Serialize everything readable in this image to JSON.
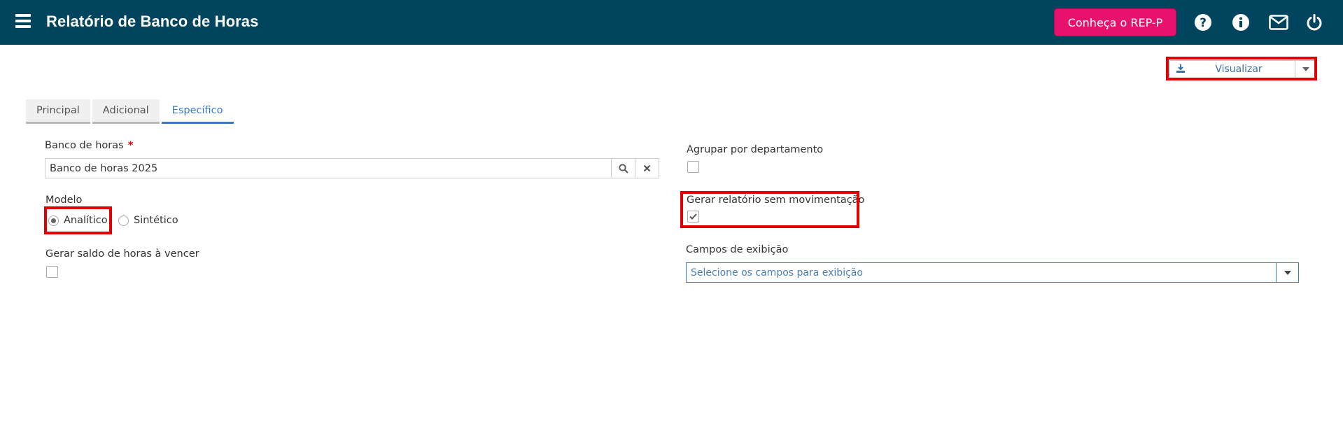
{
  "header": {
    "title": "Relatório de Banco de Horas",
    "promo_button": "Conheça o REP-P",
    "icons": [
      "help-icon",
      "info-icon",
      "mail-icon",
      "power-icon"
    ]
  },
  "toolbar": {
    "view_button": "Visualizar"
  },
  "tabs": [
    {
      "label": "Principal",
      "active": false
    },
    {
      "label": "Adicional",
      "active": false
    },
    {
      "label": "Específico",
      "active": true
    }
  ],
  "form": {
    "banco_de_horas": {
      "label": "Banco de horas",
      "required_mark": "*",
      "value": "Banco de horas 2025"
    },
    "modelo": {
      "label": "Modelo",
      "options": [
        {
          "label": "Analítico",
          "selected": true
        },
        {
          "label": "Sintético",
          "selected": false
        }
      ]
    },
    "gerar_saldo": {
      "label": "Gerar saldo de horas à vencer",
      "checked": false
    },
    "agrupar_departamento": {
      "label": "Agrupar por departamento",
      "checked": false
    },
    "sem_movimentacao": {
      "label": "Gerar relatório sem movimentação",
      "checked": true
    },
    "campos_exibicao": {
      "label": "Campos de exibição",
      "placeholder": "Selecione os campos para exibição"
    }
  },
  "colors": {
    "header_bg": "#00445e",
    "promo_bg": "#e8116c",
    "accent": "#3a7bbf",
    "highlight": "#e10000"
  }
}
